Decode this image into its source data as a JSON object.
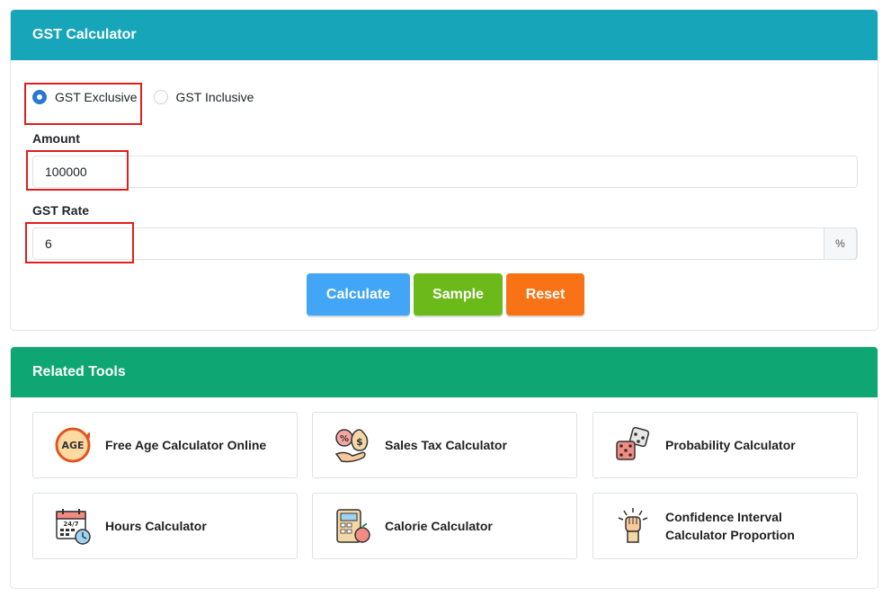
{
  "calculator": {
    "title": "GST Calculator",
    "mode_options": [
      {
        "label": "GST Exclusive",
        "selected": true
      },
      {
        "label": "GST Inclusive",
        "selected": false
      }
    ],
    "amount": {
      "label": "Amount",
      "value": "100000"
    },
    "gst_rate": {
      "label": "GST Rate",
      "value": "6",
      "suffix": "%"
    },
    "buttons": {
      "calculate": "Calculate",
      "sample": "Sample",
      "reset": "Reset"
    }
  },
  "related_tools": {
    "title": "Related Tools",
    "items": [
      {
        "label": "Free Age Calculator Online",
        "icon": "age-icon"
      },
      {
        "label": "Sales Tax Calculator",
        "icon": "sales-tax-icon"
      },
      {
        "label": "Probability Calculator",
        "icon": "dice-icon"
      },
      {
        "label": "Hours Calculator",
        "icon": "calendar-clock-icon"
      },
      {
        "label": "Calorie Calculator",
        "icon": "calculator-apple-icon"
      },
      {
        "label": "Confidence Interval\nCalculator Proportion",
        "icon": "fist-icon"
      }
    ]
  },
  "icon_text": {
    "age": "AGE",
    "hours": "24/7"
  },
  "colors": {
    "calculator_header": "#17a6b9",
    "tools_header": "#0ea774",
    "calculate_button": "#42a5f5",
    "sample_button": "#6cb91a",
    "reset_button": "#f97316",
    "highlight_box": "#e01e1e",
    "radio_selected": "#2a76d2"
  }
}
